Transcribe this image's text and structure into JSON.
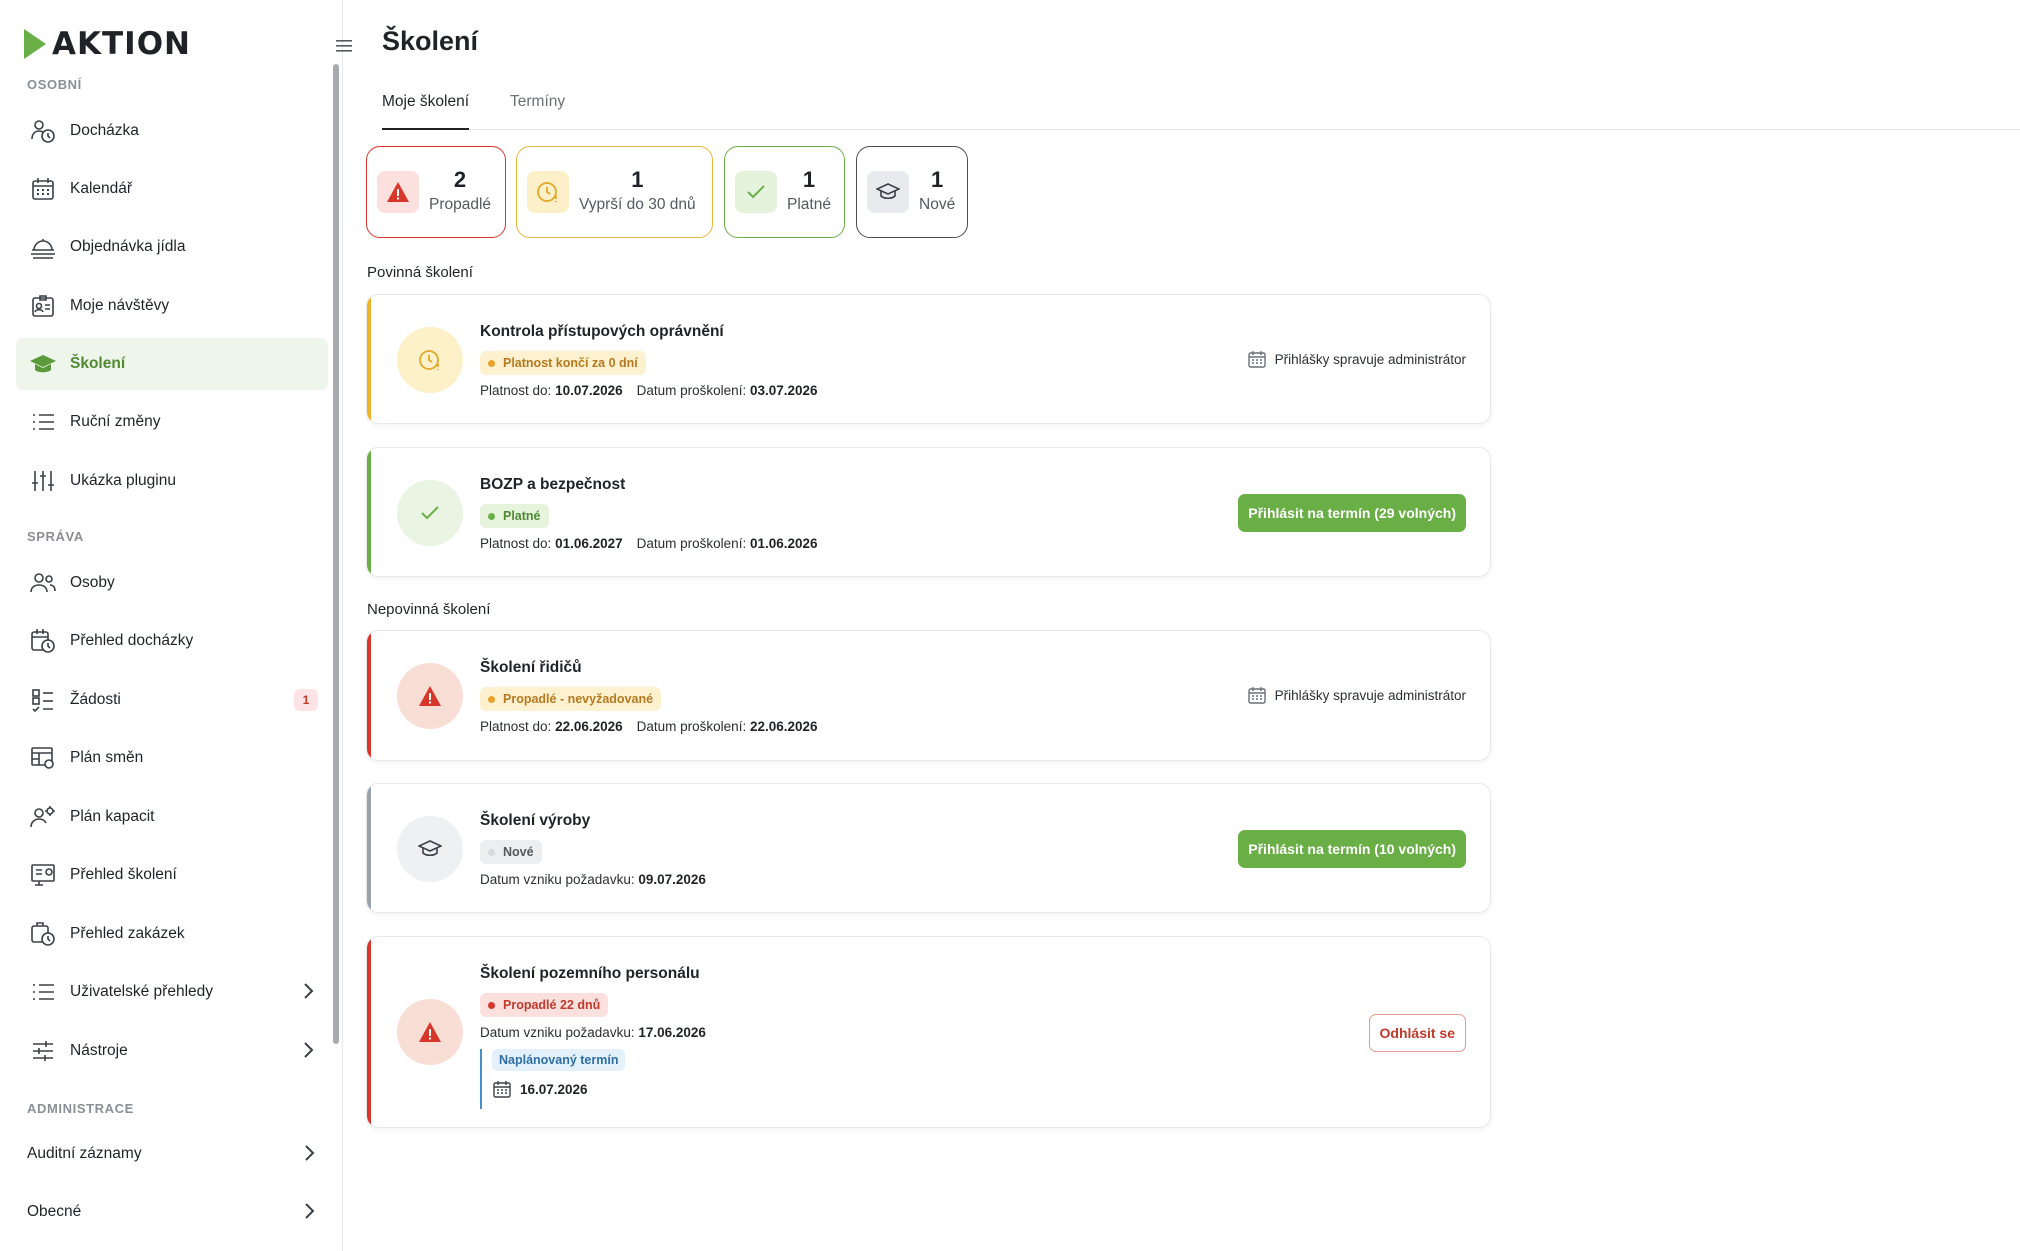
{
  "app": {
    "logo_text": "aktion"
  },
  "sidebar": {
    "sections": {
      "osobni": "OSOBNÍ",
      "sprava": "SPRÁVA",
      "administrace": "ADMINISTRACE"
    },
    "items": [
      {
        "label": "Docházka",
        "icon": "attendance-clock-icon"
      },
      {
        "label": "Kalendář",
        "icon": "calendar-icon"
      },
      {
        "label": "Objednávka jídla",
        "icon": "food-order-icon"
      },
      {
        "label": "Moje návštěvy",
        "icon": "visitor-badge-icon"
      },
      {
        "label": "Školení",
        "icon": "graduation-cap-icon",
        "active": true
      },
      {
        "label": "Ruční změny",
        "icon": "list-icon"
      },
      {
        "label": "Ukázka pluginu",
        "icon": "sliders-icon"
      },
      {
        "label": "Osoby",
        "icon": "people-icon"
      },
      {
        "label": "Přehled docházky",
        "icon": "attendance-overview-icon"
      },
      {
        "label": "Žádosti",
        "icon": "requests-icon",
        "badge": "1"
      },
      {
        "label": "Plán směn",
        "icon": "shift-plan-icon"
      },
      {
        "label": "Plán kapacit",
        "icon": "capacity-plan-icon"
      },
      {
        "label": "Přehled školení",
        "icon": "training-overview-icon"
      },
      {
        "label": "Přehled zakázek",
        "icon": "orders-overview-icon"
      },
      {
        "label": "Uživatelské přehledy",
        "icon": "list-icon"
      },
      {
        "label": "Nástroje",
        "icon": "tools-sliders-icon"
      },
      {
        "label": "Auditní záznamy"
      },
      {
        "label": "Obecné"
      }
    ]
  },
  "main": {
    "title": "Školení",
    "tabs": [
      {
        "label": "Moje školení",
        "active": true
      },
      {
        "label": "Termíny",
        "active": false
      }
    ],
    "stats": [
      {
        "value": "2",
        "label": "Propadlé",
        "color": "#d9362b"
      },
      {
        "value": "1",
        "label": "Vyprší do 30 dnů",
        "color": "#e8b83a"
      },
      {
        "value": "1",
        "label": "Platné",
        "color": "#6aae46"
      },
      {
        "value": "1",
        "label": "Nové",
        "color": "#4b4f55"
      }
    ],
    "groups": {
      "mandatory": "Povinná školení",
      "optional": "Nepovinná školení"
    },
    "labels": {
      "valid_until": "Platnost do:",
      "trained_date": "Datum proškolení:",
      "request_date": "Datum vzniku požadavku:",
      "admin_note": "Přihlášky spravuje administrátor",
      "planned_term": "Naplánovaný termín"
    },
    "trainings": [
      {
        "title": "Kontrola přístupových oprávnění",
        "status": "Platnost končí za 0 dní",
        "valid_until": "10.07.2026",
        "trained": "03.07.2026",
        "color": "#f0b429"
      },
      {
        "title": "BOZP a bezpečnost",
        "status": "Platné",
        "valid_until": "01.06.2027",
        "trained": "01.06.2026",
        "action": "Přihlásit na termín (29 volných)",
        "color": "#6aae46"
      },
      {
        "title": "Školení řidičů",
        "status": "Propadlé - nevyžadované",
        "valid_until": "22.06.2026",
        "trained": "22.06.2026",
        "color": "#d9362b"
      },
      {
        "title": "Školení výroby",
        "status": "Nové",
        "request_date": "09.07.2026",
        "action": "Přihlásit na termín (10 volných)",
        "color": "#9aa3ad"
      },
      {
        "title": "Školení pozemního personálu",
        "status": "Propadlé 22 dnů",
        "request_date": "17.06.2026",
        "planned_date": "16.07.2026",
        "action": "Odhlásit se",
        "color": "#d9362b"
      }
    ]
  }
}
